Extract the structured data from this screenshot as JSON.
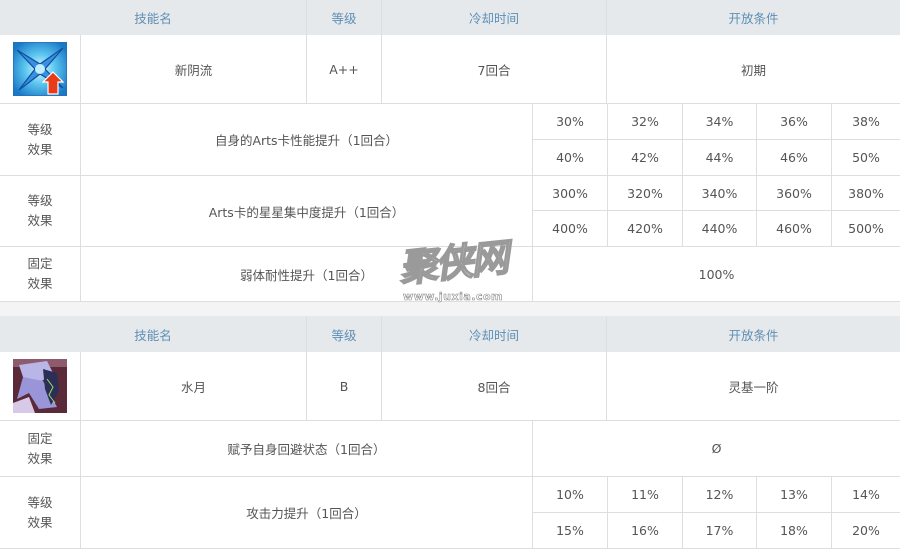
{
  "headers": {
    "skill_name": "技能名",
    "level": "等级",
    "cooldown": "冷却时间",
    "unlock": "开放条件"
  },
  "skills": [
    {
      "icon": "arts-up-icon",
      "name": "新阴流",
      "rank": "A++",
      "cooldown": "7回合",
      "unlock": "初期",
      "effects": [
        {
          "type": "等级\n效果",
          "description": "自身的Arts卡性能提升（1回合）",
          "values": [
            [
              "30%",
              "32%",
              "34%",
              "36%",
              "38%"
            ],
            [
              "40%",
              "42%",
              "44%",
              "46%",
              "50%"
            ]
          ]
        },
        {
          "type": "等级\n效果",
          "description": "Arts卡的星星集中度提升（1回合）",
          "values": [
            [
              "300%",
              "320%",
              "340%",
              "360%",
              "380%"
            ],
            [
              "400%",
              "420%",
              "440%",
              "460%",
              "500%"
            ]
          ]
        },
        {
          "type": "固定\n效果",
          "description": "弱体耐性提升（1回合）",
          "fixed_value": "100%"
        }
      ]
    },
    {
      "icon": "evade-portrait-icon",
      "name": "水月",
      "rank": "B",
      "cooldown": "8回合",
      "unlock": "灵基一阶",
      "effects": [
        {
          "type": "固定\n效果",
          "description": "赋予自身回避状态（1回合）",
          "fixed_value": "Ø"
        },
        {
          "type": "等级\n效果",
          "description": "攻击力提升（1回合）",
          "values": [
            [
              "10%",
              "11%",
              "12%",
              "13%",
              "14%"
            ],
            [
              "15%",
              "16%",
              "17%",
              "18%",
              "20%"
            ]
          ]
        }
      ]
    }
  ],
  "watermark": {
    "logo_text": "聚侠网",
    "url_text": "www.juxia.com"
  },
  "colors": {
    "header_bg": "#e6e9ec",
    "header_text": "#5e8fb5",
    "border": "#dedede",
    "body_text": "#555555"
  }
}
